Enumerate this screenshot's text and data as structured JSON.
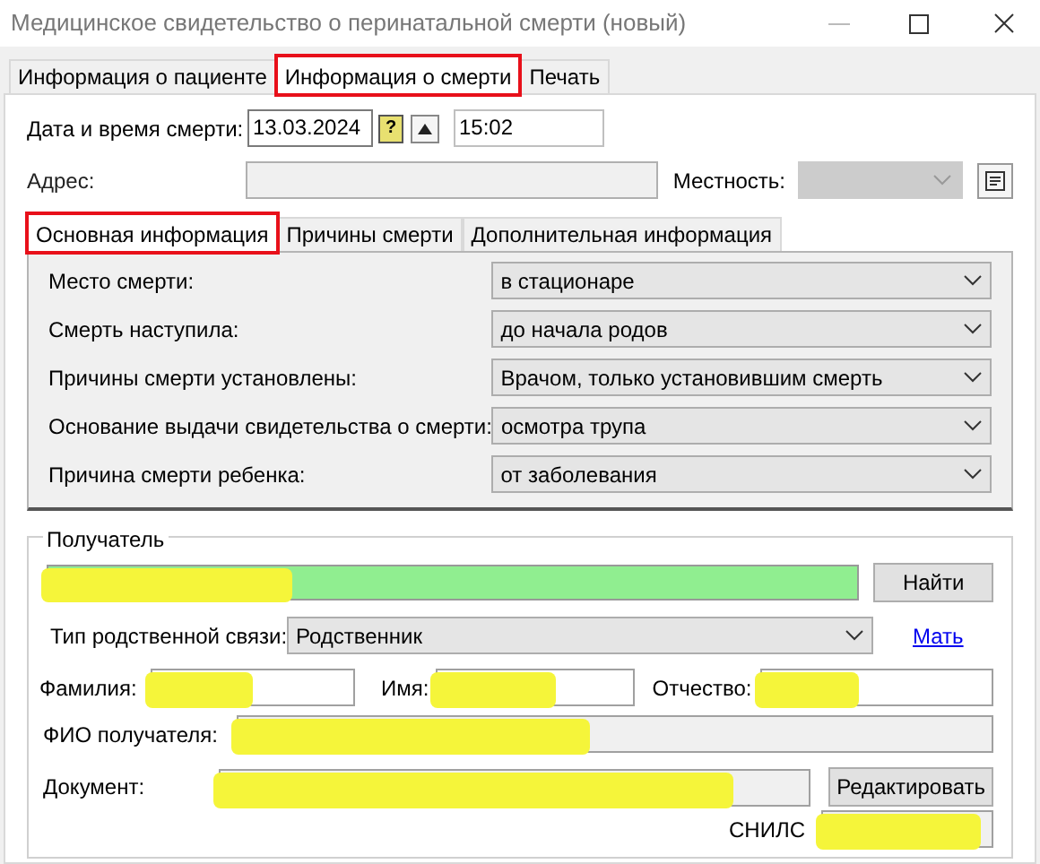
{
  "window": {
    "title": "Медицинское свидетельство о перинатальной смерти (новый)"
  },
  "tabs": [
    {
      "label": "Информация о пациенте",
      "selected": false,
      "highlighted": false
    },
    {
      "label": "Информация о смерти",
      "selected": true,
      "highlighted": true
    },
    {
      "label": "Печать",
      "selected": false,
      "highlighted": false
    }
  ],
  "death_datetime": {
    "label": "Дата и время смерти:",
    "date": "13.03.2024",
    "help_icon": "?",
    "time": "15:02"
  },
  "address": {
    "label": "Адрес:",
    "locality_label": "Местность:",
    "disabled": true
  },
  "inner_tabs": [
    {
      "label": "Основная информация",
      "selected": true,
      "highlighted": true
    },
    {
      "label": "Причины смерти",
      "selected": false,
      "highlighted": false
    },
    {
      "label": "Дополнительная информация",
      "selected": false,
      "highlighted": false
    }
  ],
  "main_fields": [
    {
      "label": "Место смерти:",
      "value": "в стационаре"
    },
    {
      "label": "Смерть наступила:",
      "value": "до начала родов"
    },
    {
      "label": "Причины смерти установлены:",
      "value": "Врачом, только установившим смерть"
    },
    {
      "label": "Основание выдачи свидетельства о смерти:",
      "value": "осмотра трупа"
    },
    {
      "label": "Причина смерти ребенка:",
      "value": "от заболевания"
    }
  ],
  "recipient": {
    "title": "Получатель",
    "search": {
      "redacted": true
    },
    "find_button": "Найти",
    "relation_label": "Тип родственной связи:",
    "relation_value": "Родственник",
    "relation_link": "Мать",
    "surname_label": "Фамилия:",
    "surname": {
      "redacted": true
    },
    "name_label": "Имя:",
    "name": {
      "redacted": true
    },
    "patronymic_label": "Отчество:",
    "patronymic": {
      "redacted": true
    },
    "full_name_label": "ФИО получателя:",
    "full_name": {
      "redacted": true
    },
    "document_label": "Документ:",
    "document": {
      "redacted": true
    },
    "edit_button": "Редактировать",
    "snils_label": "СНИЛС",
    "snils": {
      "redacted": true
    }
  }
}
